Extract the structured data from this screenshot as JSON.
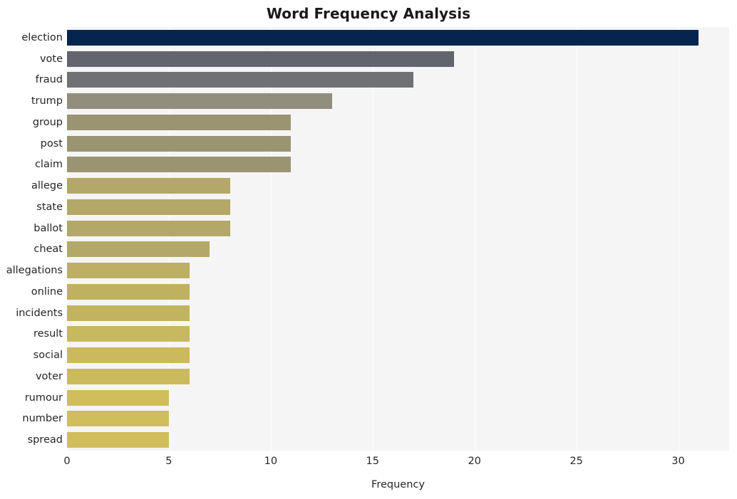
{
  "chart_data": {
    "type": "bar",
    "orientation": "horizontal",
    "title": "Word Frequency Analysis",
    "xlabel": "Frequency",
    "ylabel": "",
    "xlim": [
      0,
      32.5
    ],
    "xticks": [
      0,
      5,
      10,
      15,
      20,
      25,
      30
    ],
    "xtick_labels": [
      "0",
      "5",
      "10",
      "15",
      "20",
      "25",
      "30"
    ],
    "grid": true,
    "grid_axis": "x",
    "legend": "none",
    "categories": [
      "election",
      "vote",
      "fraud",
      "trump",
      "group",
      "post",
      "claim",
      "allege",
      "state",
      "ballot",
      "cheat",
      "allegations",
      "online",
      "incidents",
      "result",
      "social",
      "voter",
      "rumour",
      "number",
      "spread"
    ],
    "values": [
      31,
      19,
      17,
      13,
      11,
      11,
      11,
      8,
      8,
      8,
      7,
      6,
      6,
      6,
      6,
      6,
      6,
      5,
      5,
      5
    ],
    "bar_colors": [
      "#05254e",
      "#62646e",
      "#707175",
      "#918e7d",
      "#9b9473",
      "#9b9473",
      "#9b9473",
      "#b3a867",
      "#b3a867",
      "#b3a867",
      "#b3a86a",
      "#bdaf63",
      "#c0b161",
      "#c2b360",
      "#c8b85e",
      "#cbba5d",
      "#cbba5d",
      "#d0bd5c",
      "#d0bd5c",
      "#d0bd5c"
    ]
  },
  "figure": {
    "background": "#ffffff",
    "plot_background": "#f5f5f5",
    "gridline_color": "#ffffff",
    "text_color": "#262626",
    "title_color": "#1a1a1a"
  }
}
